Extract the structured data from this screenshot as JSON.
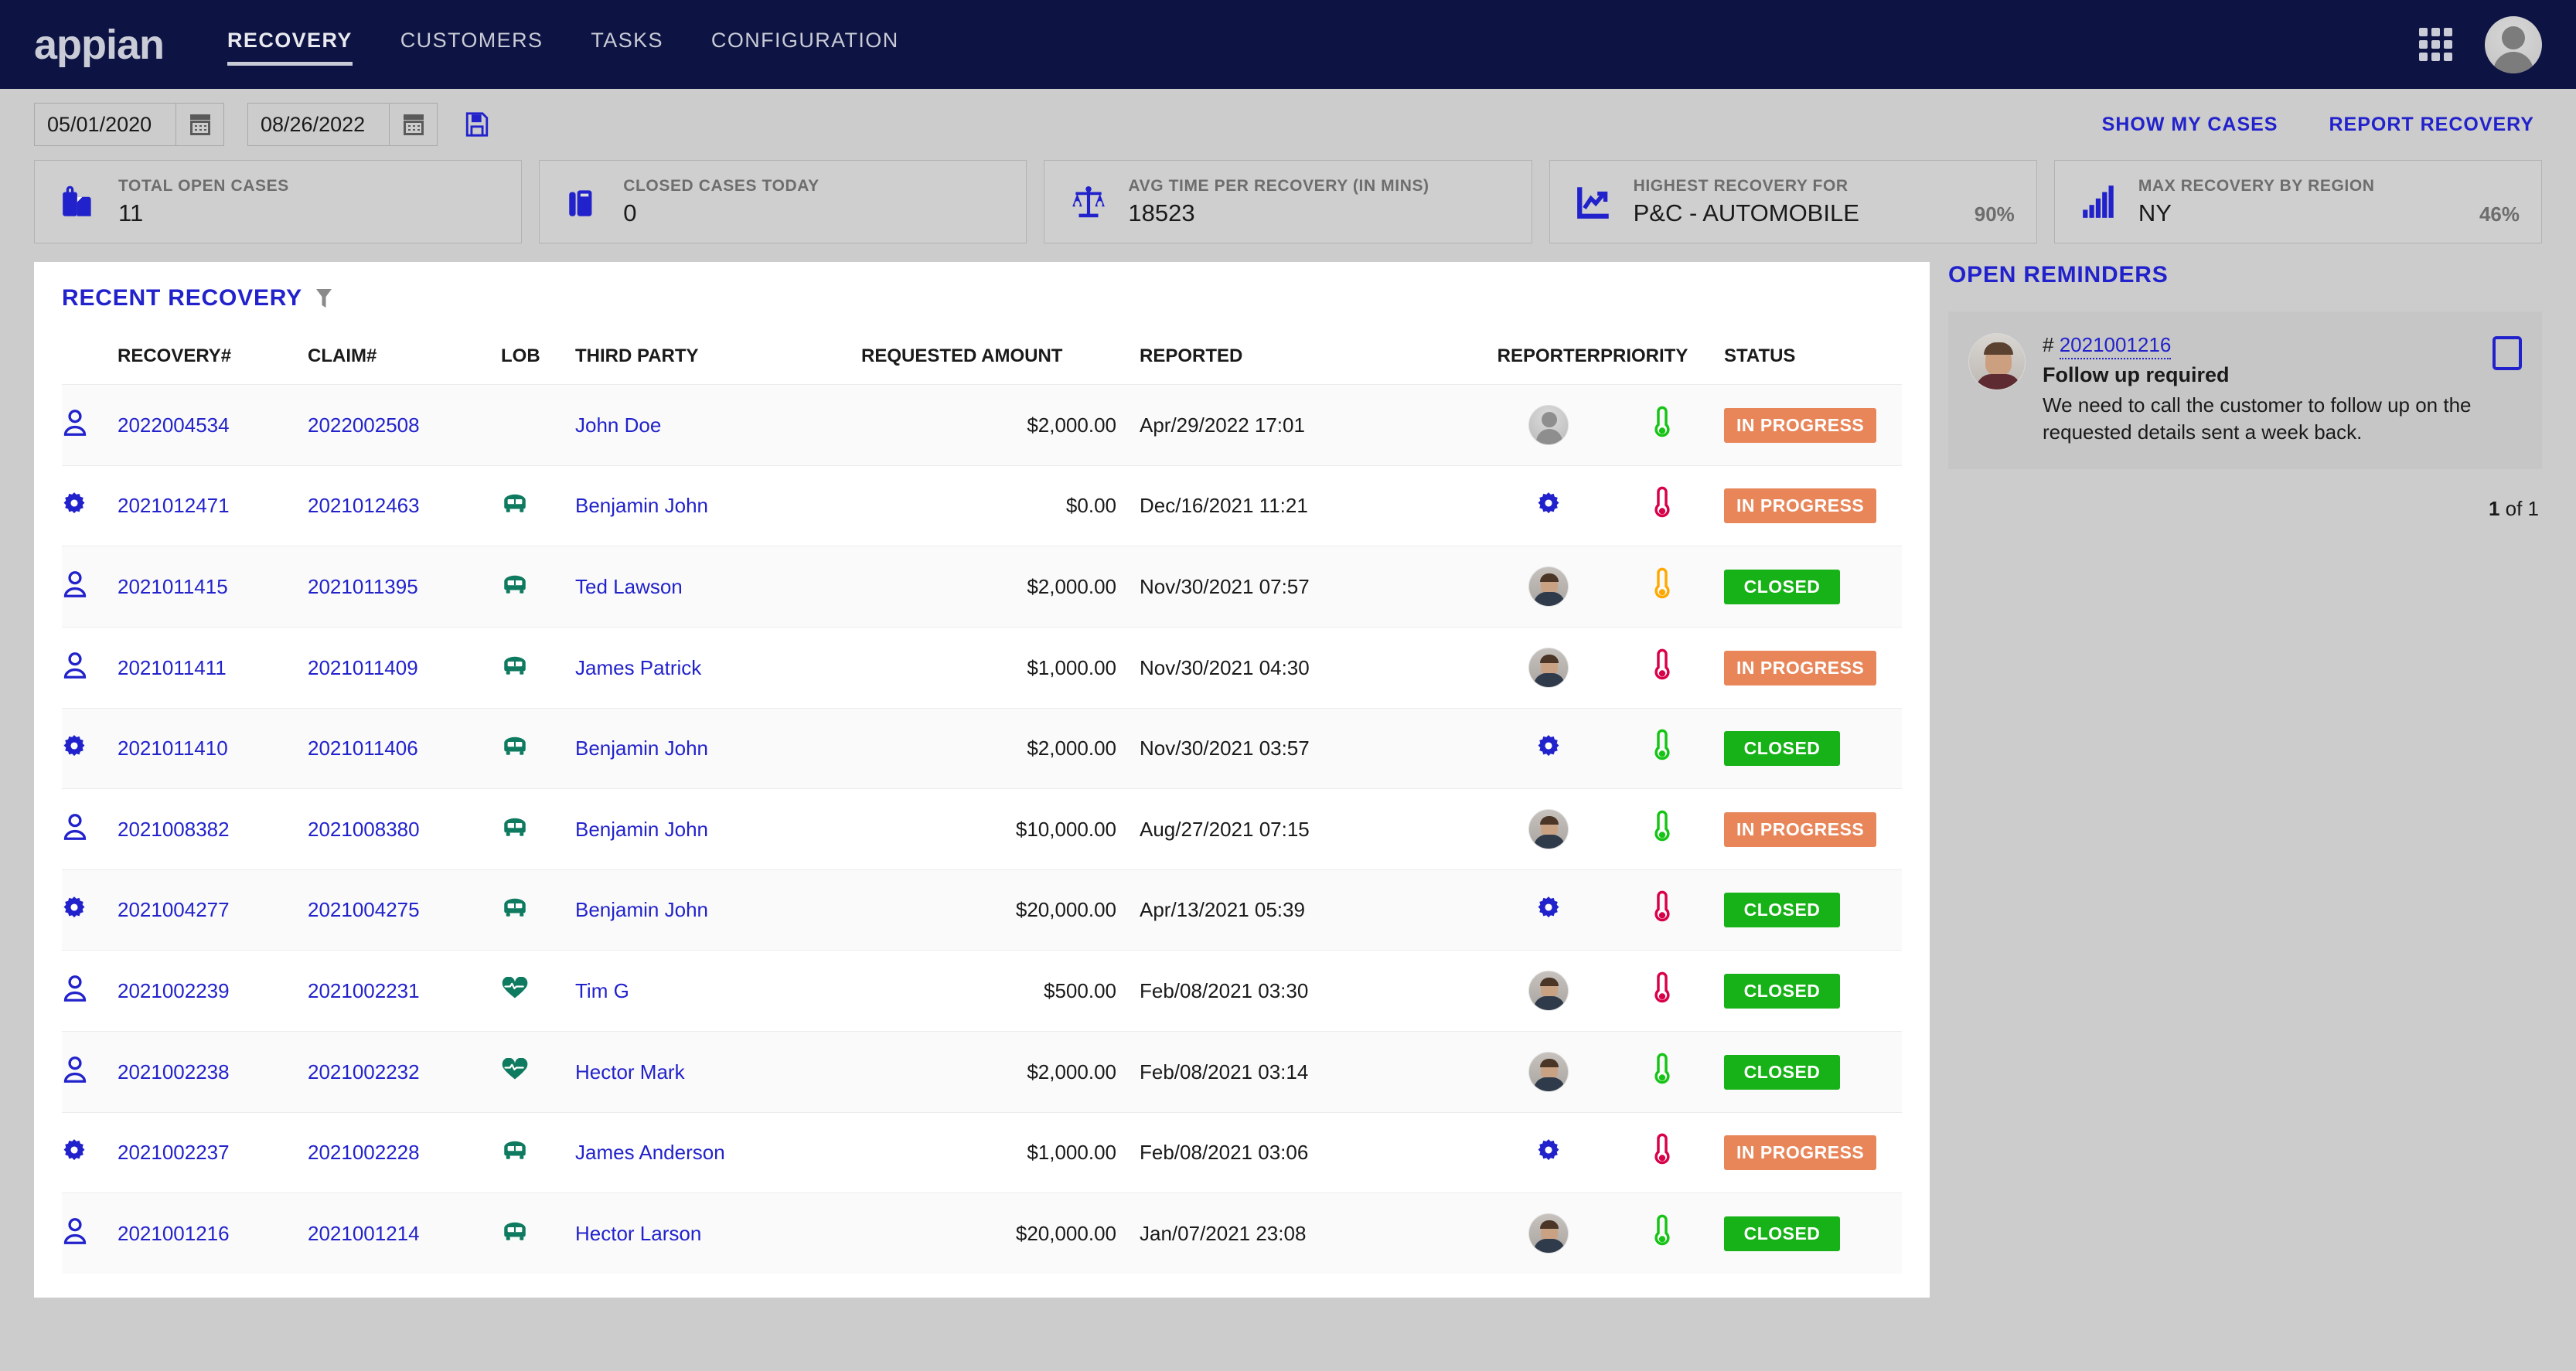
{
  "nav": {
    "logo": "appian",
    "items": [
      {
        "label": "RECOVERY",
        "active": true
      },
      {
        "label": "CUSTOMERS",
        "active": false
      },
      {
        "label": "TASKS",
        "active": false
      },
      {
        "label": "CONFIGURATION",
        "active": false
      }
    ],
    "grid_icon": "apps-grid-icon",
    "avatar_icon": "user-avatar"
  },
  "filters": {
    "start_date": "05/01/2020",
    "end_date": "08/26/2022",
    "calendar_icon": "calendar-icon",
    "save_icon": "save-icon",
    "actions": [
      {
        "label": "SHOW MY CASES"
      },
      {
        "label": "REPORT RECOVERY"
      }
    ]
  },
  "kpis": [
    {
      "label": "TOTAL OPEN CASES",
      "value": "11",
      "pct": "",
      "icon": "briefcase-icon"
    },
    {
      "label": "CLOSED CASES TODAY",
      "value": "0",
      "pct": "",
      "icon": "suitcase-icon"
    },
    {
      "label": "AVG TIME PER RECOVERY (IN MINS)",
      "value": "18523",
      "pct": "",
      "icon": "scales-icon"
    },
    {
      "label": "HIGHEST RECOVERY FOR",
      "value": "P&C - AUTOMOBILE",
      "pct": "90%",
      "icon": "trend-chart-icon"
    },
    {
      "label": "MAX RECOVERY BY REGION",
      "value": "NY",
      "pct": "46%",
      "icon": "bar-chart-icon"
    }
  ],
  "table": {
    "title": "RECENT RECOVERY",
    "filter_icon": "funnel-icon",
    "columns": [
      "RECOVERY#",
      "CLAIM#",
      "LOB",
      "THIRD PARTY",
      "REQUESTED AMOUNT",
      "REPORTED",
      "REPORTER",
      "PRIORITY",
      "STATUS"
    ],
    "rows": [
      {
        "type_icon": "person-icon",
        "recovery": "2022004534",
        "claim": "2022002508",
        "lob": "",
        "third_party": "John Doe",
        "amount": "$2,000.00",
        "reported": "Apr/29/2022 17:01",
        "reporter": "generic-avatar",
        "priority": "low",
        "status": "IN PROGRESS"
      },
      {
        "type_icon": "gear-icon",
        "recovery": "2021012471",
        "claim": "2021012463",
        "lob": "bus-icon",
        "third_party": "Benjamin John",
        "amount": "$0.00",
        "reported": "Dec/16/2021 11:21",
        "reporter": "gear-icon",
        "priority": "high",
        "status": "IN PROGRESS"
      },
      {
        "type_icon": "person-icon",
        "recovery": "2021011415",
        "claim": "2021011395",
        "lob": "bus-icon",
        "third_party": "Ted Lawson",
        "amount": "$2,000.00",
        "reported": "Nov/30/2021 07:57",
        "reporter": "photo-avatar",
        "priority": "medium",
        "status": "CLOSED"
      },
      {
        "type_icon": "person-icon",
        "recovery": "2021011411",
        "claim": "2021011409",
        "lob": "bus-icon",
        "third_party": "James Patrick",
        "amount": "$1,000.00",
        "reported": "Nov/30/2021 04:30",
        "reporter": "photo-avatar",
        "priority": "high",
        "status": "IN PROGRESS"
      },
      {
        "type_icon": "gear-icon",
        "recovery": "2021011410",
        "claim": "2021011406",
        "lob": "bus-icon",
        "third_party": "Benjamin John",
        "amount": "$2,000.00",
        "reported": "Nov/30/2021 03:57",
        "reporter": "gear-icon",
        "priority": "low",
        "status": "CLOSED"
      },
      {
        "type_icon": "person-icon",
        "recovery": "2021008382",
        "claim": "2021008380",
        "lob": "bus-icon",
        "third_party": "Benjamin John",
        "amount": "$10,000.00",
        "reported": "Aug/27/2021 07:15",
        "reporter": "photo-avatar",
        "priority": "low",
        "status": "IN PROGRESS"
      },
      {
        "type_icon": "gear-icon",
        "recovery": "2021004277",
        "claim": "2021004275",
        "lob": "bus-icon",
        "third_party": "Benjamin John",
        "amount": "$20,000.00",
        "reported": "Apr/13/2021 05:39",
        "reporter": "gear-icon",
        "priority": "high",
        "status": "CLOSED"
      },
      {
        "type_icon": "person-icon",
        "recovery": "2021002239",
        "claim": "2021002231",
        "lob": "heart-pulse-icon",
        "third_party": "Tim G",
        "amount": "$500.00",
        "reported": "Feb/08/2021 03:30",
        "reporter": "photo-avatar",
        "priority": "high",
        "status": "CLOSED"
      },
      {
        "type_icon": "person-icon",
        "recovery": "2021002238",
        "claim": "2021002232",
        "lob": "heart-pulse-icon",
        "third_party": "Hector Mark",
        "amount": "$2,000.00",
        "reported": "Feb/08/2021 03:14",
        "reporter": "photo-avatar",
        "priority": "low",
        "status": "CLOSED"
      },
      {
        "type_icon": "gear-icon",
        "recovery": "2021002237",
        "claim": "2021002228",
        "lob": "bus-icon",
        "third_party": "James Anderson",
        "amount": "$1,000.00",
        "reported": "Feb/08/2021 03:06",
        "reporter": "gear-icon",
        "priority": "high",
        "status": "IN PROGRESS"
      },
      {
        "type_icon": "person-icon",
        "recovery": "2021001216",
        "claim": "2021001214",
        "lob": "bus-icon",
        "third_party": "Hector Larson",
        "amount": "$20,000.00",
        "reported": "Jan/07/2021 23:08",
        "reporter": "photo-avatar",
        "priority": "low",
        "status": "CLOSED"
      }
    ]
  },
  "reminders": {
    "title": "OPEN REMINDERS",
    "card": {
      "hash": "#",
      "id": "2021001216",
      "heading": "Follow up required",
      "text": "We need to call the customer to follow up on the requested details sent a week back."
    },
    "pager_current": "1",
    "pager_suffix": " of 1"
  },
  "colors": {
    "navy": "#0d1343",
    "link_blue": "#2222cc",
    "status_inprogress": "#e8865a",
    "status_closed": "#17b217",
    "lob_green": "#0e7a5f",
    "priority_low": "#15c415",
    "priority_medium": "#ffa900",
    "priority_high": "#d9004a"
  }
}
